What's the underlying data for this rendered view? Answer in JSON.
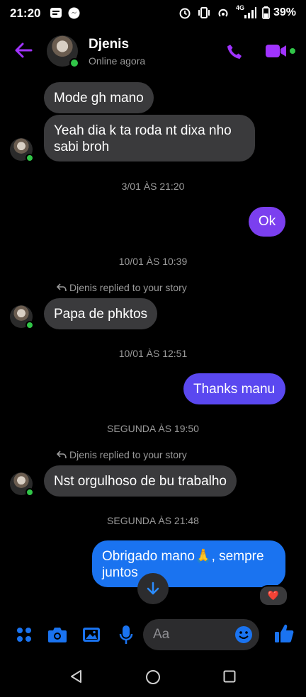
{
  "status": {
    "time": "21:20",
    "battery": "39%",
    "network": "4G"
  },
  "header": {
    "name": "Djenis",
    "presence": "Online agora"
  },
  "messages": [
    {
      "text": "Mode gh mano"
    },
    {
      "text": "Yeah dia k ta roda nt dixa nho sabi broh"
    },
    {
      "text": "3/01 ÀS 21:20"
    },
    {
      "text": "Ok"
    },
    {
      "text": "10/01 ÀS 10:39"
    },
    {
      "text": "Djenis replied to your story"
    },
    {
      "text": "Papa de phktos"
    },
    {
      "text": "10/01 ÀS 12:51"
    },
    {
      "text": "Thanks manu"
    },
    {
      "text": "SEGUNDA ÀS 19:50"
    },
    {
      "text": "Djenis replied to your story"
    },
    {
      "text": "Nst orgulhoso de bu trabalho"
    },
    {
      "text": "SEGUNDA ÀS 21:48"
    },
    {
      "text": "Obrigado mano🙏, sempre juntos"
    }
  ],
  "reaction": "❤️",
  "composer": {
    "placeholder": "Aa"
  },
  "colors": {
    "accent_purple": "#a033ff",
    "accent_blue": "#1a73f0",
    "online_green": "#31c548"
  }
}
